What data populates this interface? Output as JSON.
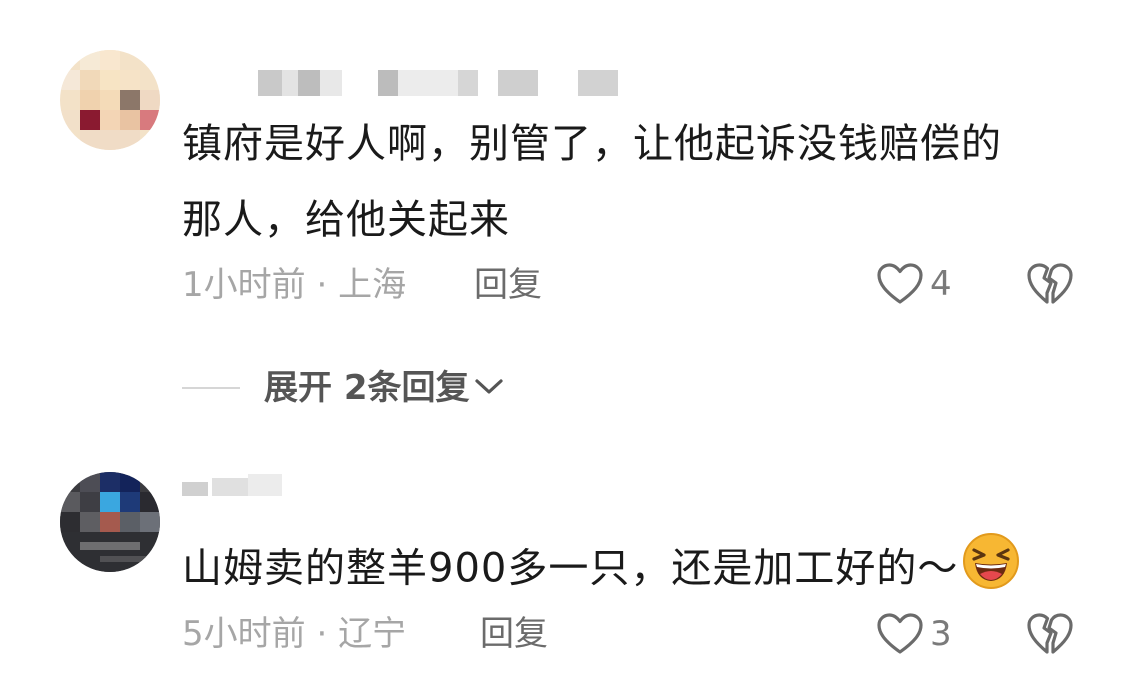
{
  "comments": [
    {
      "text_line1": "镇府是好人啊，别管了，让他起诉没钱赔偿的",
      "text_line2": "那人，给他关起来",
      "time": "1小时前",
      "location": "上海",
      "reply_label": "回复",
      "likes": "4"
    },
    {
      "text": "山姆卖的整羊900多一只，还是加工好的～",
      "time": "5小时前",
      "location": "辽宁",
      "reply_label": "回复",
      "likes": "3"
    }
  ],
  "expand": {
    "label": "展开 2条回复"
  },
  "meta_separator": " · ",
  "colors": {
    "text": "#1a1a1a",
    "meta": "#a6a6a6",
    "icon_stroke": "#6b6b6b",
    "emoji": "#f5a623"
  }
}
